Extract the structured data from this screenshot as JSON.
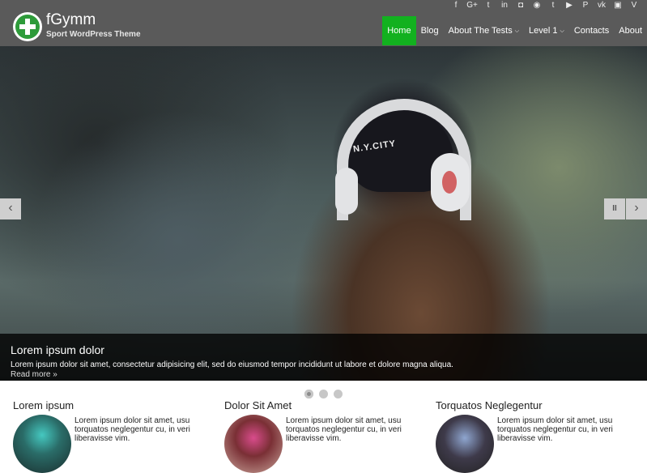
{
  "site": {
    "title": "fGymm",
    "tagline": "Sport WordPress Theme"
  },
  "social_icons": [
    "facebook-icon",
    "google-plus-icon",
    "twitter-icon",
    "linkedin-icon",
    "instagram-icon",
    "rss-icon",
    "tumblr-icon",
    "youtube-icon",
    "pinterest-icon",
    "vk-icon",
    "flickr-icon",
    "vimeo-icon"
  ],
  "social_glyphs": [
    "f",
    "G+",
    "t",
    "in",
    "◘",
    "◉",
    "t",
    "▶",
    "P",
    "vk",
    "▣",
    "V"
  ],
  "nav": {
    "items": [
      {
        "label": "Home",
        "active": true
      },
      {
        "label": "Blog"
      },
      {
        "label": "About The Tests",
        "dropdown": true
      },
      {
        "label": "Level 1",
        "dropdown": true
      },
      {
        "label": "Contacts"
      },
      {
        "label": "About"
      }
    ],
    "active_color": "#12b11f"
  },
  "slider": {
    "caption_title": "Lorem ipsum dolor",
    "caption_text": "Lorem ipsum dolor sit amet, consectetur adipisicing elit, sed do eiusmod tempor incididunt ut labore et dolore magna aliqua.",
    "read_more": "Read more »",
    "cap_text": "N.Y.CITY",
    "prev": "‹",
    "next": "›",
    "pause": "II",
    "dots": 3,
    "active_dot": 1
  },
  "columns": [
    {
      "title": "Lorem ipsum",
      "text": "Lorem ipsum dolor sit amet, usu torquatos neglegentur cu, in veri liberavisse vim."
    },
    {
      "title": "Dolor Sit Amet",
      "text": "Lorem ipsum dolor sit amet, usu torquatos neglegentur cu, in veri liberavisse vim."
    },
    {
      "title": "Torquatos Neglegentur",
      "text": "Lorem ipsum dolor sit amet, usu torquatos neglegentur cu, in veri liberavisse vim."
    }
  ],
  "colors": {
    "header": "#5a5a5a",
    "accent": "#12b11f",
    "logo": "#2e9b3a"
  }
}
